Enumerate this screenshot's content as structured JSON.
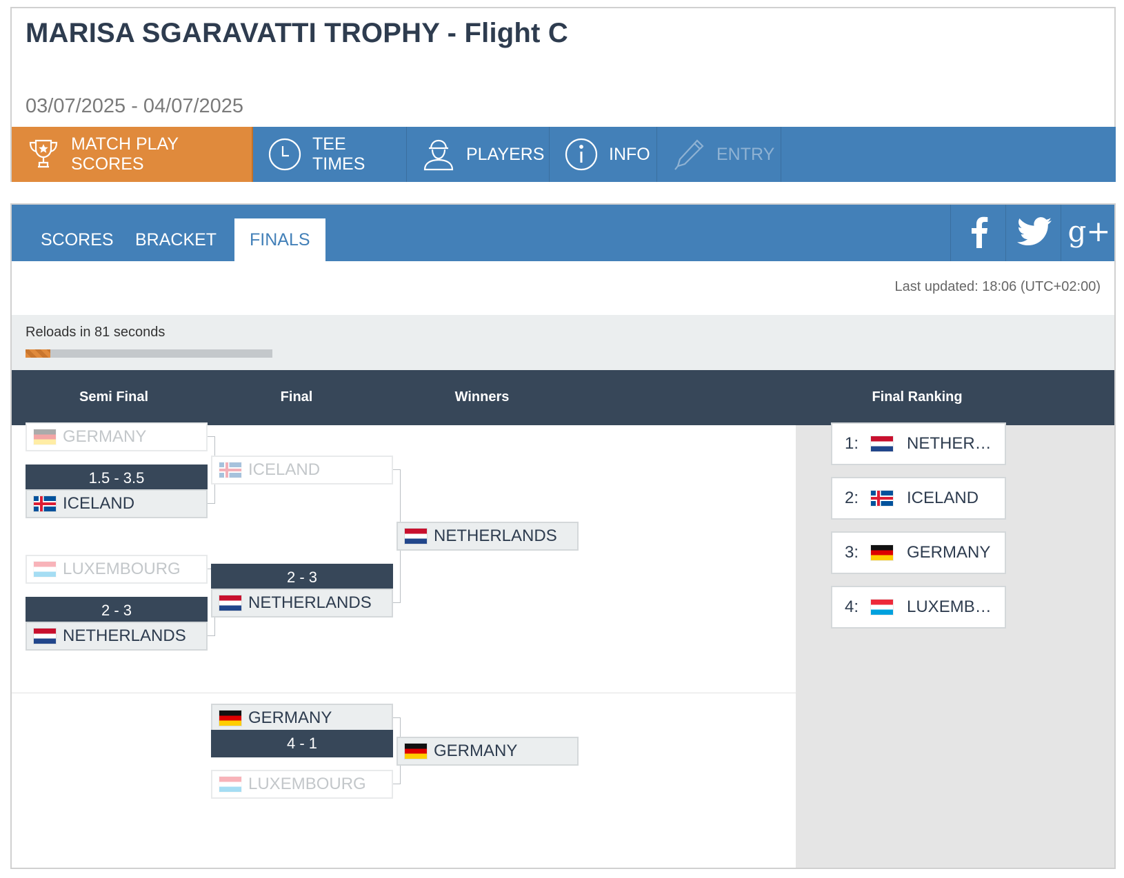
{
  "header": {
    "title": "MARISA SGARAVATTI TROPHY - Flight C",
    "dates": "03/07/2025 - 04/07/2025"
  },
  "main_nav": [
    {
      "label": "MATCH PLAY SCORES",
      "icon": "trophy-icon",
      "active": true
    },
    {
      "label": "TEE TIMES",
      "icon": "clock-icon"
    },
    {
      "label": "PLAYERS",
      "icon": "player-icon"
    },
    {
      "label": "INFO",
      "icon": "info-icon"
    },
    {
      "label": "ENTRY",
      "icon": "pencil-icon",
      "disabled": true
    }
  ],
  "sub_nav": {
    "tabs": [
      {
        "label": "SCORES"
      },
      {
        "label": "BRACKET"
      },
      {
        "label": "FINALS",
        "active": true
      }
    ],
    "social": [
      "facebook-icon",
      "twitter-icon",
      "google-plus-icon"
    ],
    "gplus_label": "g+"
  },
  "status": {
    "last_updated": "Last updated: 18:06 (UTC+02:00)",
    "reload_text": "Reloads in 81 seconds",
    "reload_progress": 0.1
  },
  "columns": {
    "semi_final": "Semi Final",
    "final": "Final",
    "winners": "Winners",
    "final_ranking": "Final Ranking"
  },
  "semi_finals": [
    {
      "top": {
        "team": "GERMANY",
        "flag": "de"
      },
      "score": "1.5 - 3.5",
      "bottom": {
        "team": "ICELAND",
        "flag": "is"
      }
    },
    {
      "top": {
        "team": "LUXEMBOURG",
        "flag": "lu"
      },
      "score": "2 - 3",
      "bottom": {
        "team": "NETHERLANDS",
        "flag": "nl"
      }
    }
  ],
  "final": {
    "top": {
      "team": "ICELAND",
      "flag": "is"
    },
    "score": "2 - 3",
    "bottom": {
      "team": "NETHERLANDS",
      "flag": "nl"
    },
    "winner": {
      "team": "NETHERLANDS",
      "flag": "nl"
    }
  },
  "third_place": {
    "top": {
      "team": "GERMANY",
      "flag": "de"
    },
    "score": "4 - 1",
    "bottom": {
      "team": "LUXEMBOURG",
      "flag": "lu"
    },
    "winner": {
      "team": "GERMANY",
      "flag": "de"
    }
  },
  "ranking": [
    {
      "pos": "1:",
      "team": "NETHERLANDS",
      "flag": "nl"
    },
    {
      "pos": "2:",
      "team": "ICELAND",
      "flag": "is"
    },
    {
      "pos": "3:",
      "team": "GERMANY",
      "flag": "de"
    },
    {
      "pos": "4:",
      "team": "LUXEMBOURG",
      "flag": "lu"
    }
  ],
  "colors": {
    "nav_blue": "#4380b8",
    "active_orange": "#e08a3c",
    "dark_header": "#374759"
  }
}
